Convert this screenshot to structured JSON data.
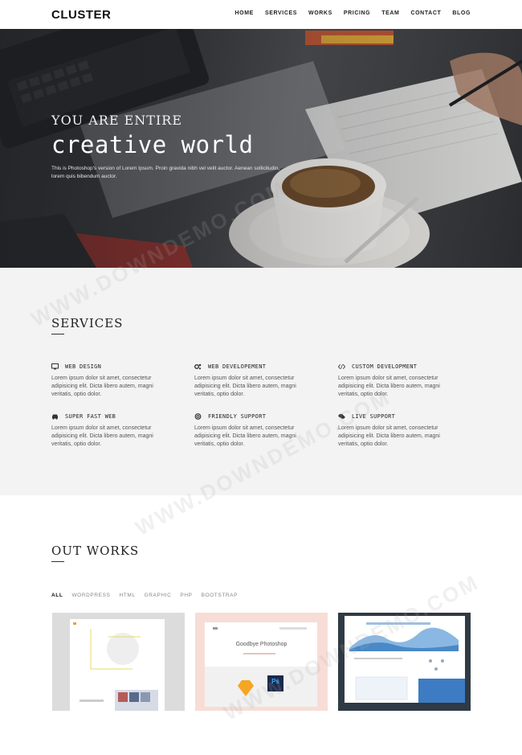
{
  "nav": {
    "logo": "CLUSTER",
    "items": [
      "HOME",
      "SERVICES",
      "WORKS",
      "PRICING",
      "TEAM",
      "CONTACT",
      "BLOG"
    ]
  },
  "hero": {
    "subtitle": "YOU ARE ENTIRE",
    "title": "creative world",
    "description": "This is Photoshop's version of Lorem Ipsum. Proin gravida nibh vel velit auctor. Aenean sollicitudin, lorem quis bibendum auctor."
  },
  "services": {
    "heading": "SERVICES",
    "items": [
      {
        "icon": "monitor-icon",
        "title": "WEB DESIGN",
        "text": "Lorem ipsum dolor sit amet, consectetur adipisicing elit. Dicta libero autem, magni veritatis, optio dolor."
      },
      {
        "icon": "gears-icon",
        "title": "WEB DEVELOPEMENT",
        "text": "Lorem ipsum dolor sit amet, consectetur adipisicing elit. Dicta libero autem, magni veritatis, optio dolor."
      },
      {
        "icon": "code-icon",
        "title": "CUSTOM DEVELOPMENT",
        "text": "Lorem ipsum dolor sit amet, consectetur adipisicing elit. Dicta libero autem, magni veritatis, optio dolor."
      },
      {
        "icon": "car-icon",
        "title": "SUPER FAST WEB",
        "text": "Lorem ipsum dolor sit amet, consectetur adipisicing elit. Dicta libero autem, magni veritatis, optio dolor."
      },
      {
        "icon": "support-icon",
        "title": "FRIENDLY SUPPORT",
        "text": "Lorem ipsum dolor sit amet, consectetur adipisicing elit. Dicta libero autem, magni veritatis, optio dolor."
      },
      {
        "icon": "chat-icon",
        "title": "LIVE SUPPORT",
        "text": "Lorem ipsum dolor sit amet, consectetur adipisicing elit. Dicta libero autem, magni veritatis, optio dolor."
      }
    ]
  },
  "works": {
    "heading": "OUT WORKS",
    "filters": [
      "ALL",
      "WORDPRESS",
      "HTML",
      "GRAPHIC",
      "PHP",
      "BOOTSTRAP"
    ],
    "active_filter": "ALL",
    "cards": [
      {
        "name": "portfolio-card-1",
        "text": ""
      },
      {
        "name": "portfolio-card-2",
        "text": "Goodbye Photoshop",
        "badge": "Ps"
      },
      {
        "name": "portfolio-card-3",
        "text": ""
      }
    ]
  },
  "watermark": "WWW.DOWNDEMO.COM"
}
